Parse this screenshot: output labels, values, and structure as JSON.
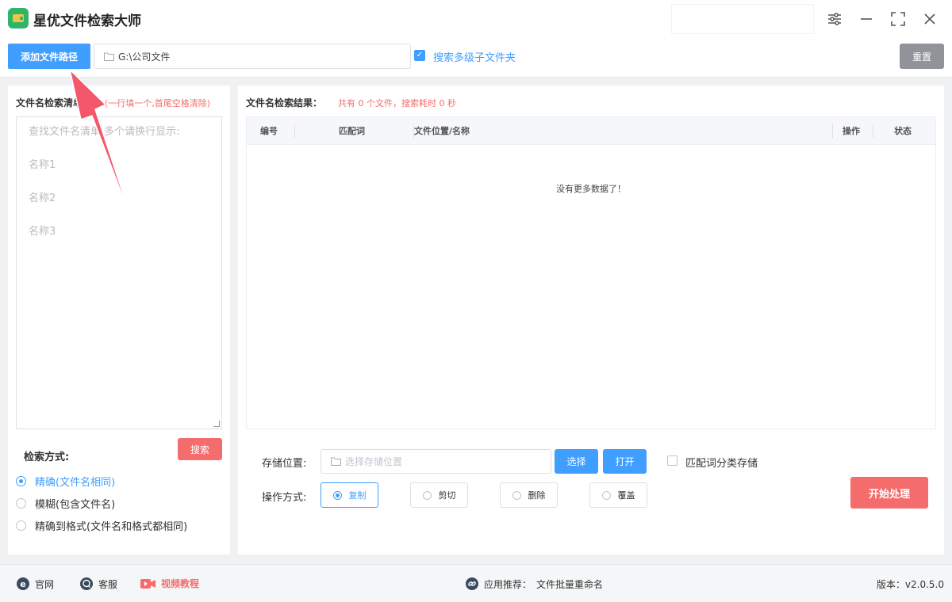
{
  "app": {
    "title": "星优文件检索大师"
  },
  "toolbar": {
    "add_path_label": "添加文件路径",
    "path_value": "G:\\公司文件",
    "subfolder_checked": true,
    "subfolder_label": "搜索多级子文件夹",
    "reset_label": "重置"
  },
  "left": {
    "title": "文件名检索清单：",
    "hint": "(一行填一个,首尾空格清除)",
    "placeholder_lines": [
      "查找文件名清单,多个请换行显示:",
      "名称1",
      "名称2",
      "名称3"
    ],
    "search_label": "搜索",
    "mode_title": "检索方式:",
    "modes": [
      {
        "label": "精确(文件名相同)",
        "selected": true
      },
      {
        "label": "模糊(包含文件名)",
        "selected": false
      },
      {
        "label": "精确到格式(文件名和格式都相同)",
        "selected": false
      }
    ]
  },
  "right": {
    "title": "文件名检索结果：",
    "stats": "共有 0 个文件，搜索耗时 0 秒",
    "columns": [
      "编号",
      "匹配词",
      "文件位置/名称",
      "操作",
      "状态"
    ],
    "empty_text": "没有更多数据了！",
    "storage_label": "存储位置:",
    "storage_placeholder": "选择存储位置",
    "choose_label": "选择",
    "open_label": "打开",
    "classify_label": "匹配词分类存储",
    "classify_checked": false,
    "operation_label": "操作方式:",
    "operations": [
      {
        "label": "复制",
        "selected": true
      },
      {
        "label": "剪切",
        "selected": false
      },
      {
        "label": "删除",
        "selected": false
      },
      {
        "label": "覆盖",
        "selected": false
      }
    ],
    "start_label": "开始处理"
  },
  "footer": {
    "website": "官网",
    "support": "客服",
    "video": "视频教程",
    "recommend_label": "应用推荐：",
    "recommend_app": "文件批量重命名",
    "version": "版本：v2.0.5.0"
  },
  "colors": {
    "primary": "#409eff",
    "danger": "#f56c6c",
    "gray": "#909399",
    "logo_green": "#2fb46c",
    "arrow": "#f4566a"
  }
}
